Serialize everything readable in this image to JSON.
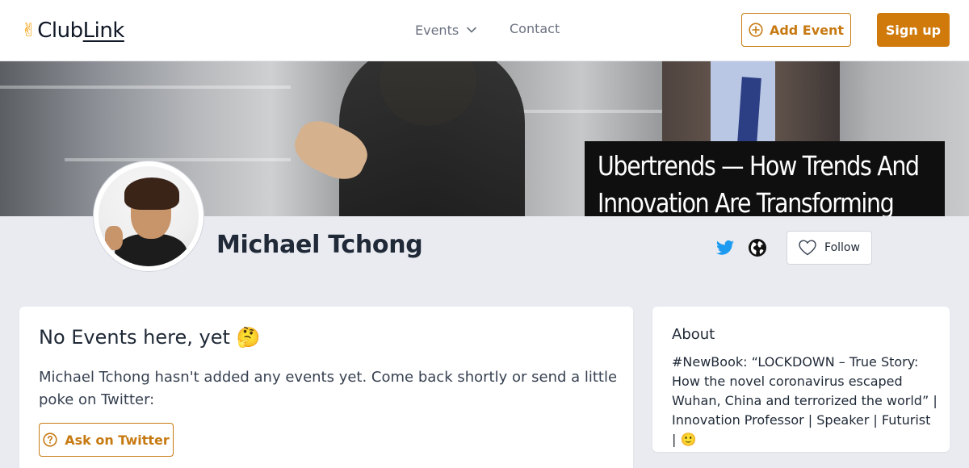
{
  "header": {
    "logo_icon": "peace-hand-icon",
    "logo_text_a": "Club",
    "logo_text_b": "Link",
    "nav_events": "Events",
    "nav_contact": "Contact",
    "add_event": "Add Event",
    "sign_up": "Sign up",
    "accent_color": "#d07a0b"
  },
  "banner": {
    "caption_line1": "Ubertrends — How Trends And",
    "caption_line2": "Innovation Are Transforming"
  },
  "profile": {
    "name": "Michael Tchong",
    "follow_label": "Follow",
    "social_icons": [
      "twitter-icon",
      "globe-icon"
    ]
  },
  "events_card": {
    "title": "No Events here, yet 🤔",
    "text": "Michael Tchong hasn't added any events yet. Come back shortly or send a little poke on Twitter:",
    "ask_button": "Ask on Twitter"
  },
  "about_card": {
    "title": "About",
    "text": "#NewBook: “LOCKDOWN – True Story: How the novel coronavirus escaped Wuhan, China and terrorized the world” | Innovation Professor | Speaker | Futurist | 🙂"
  }
}
